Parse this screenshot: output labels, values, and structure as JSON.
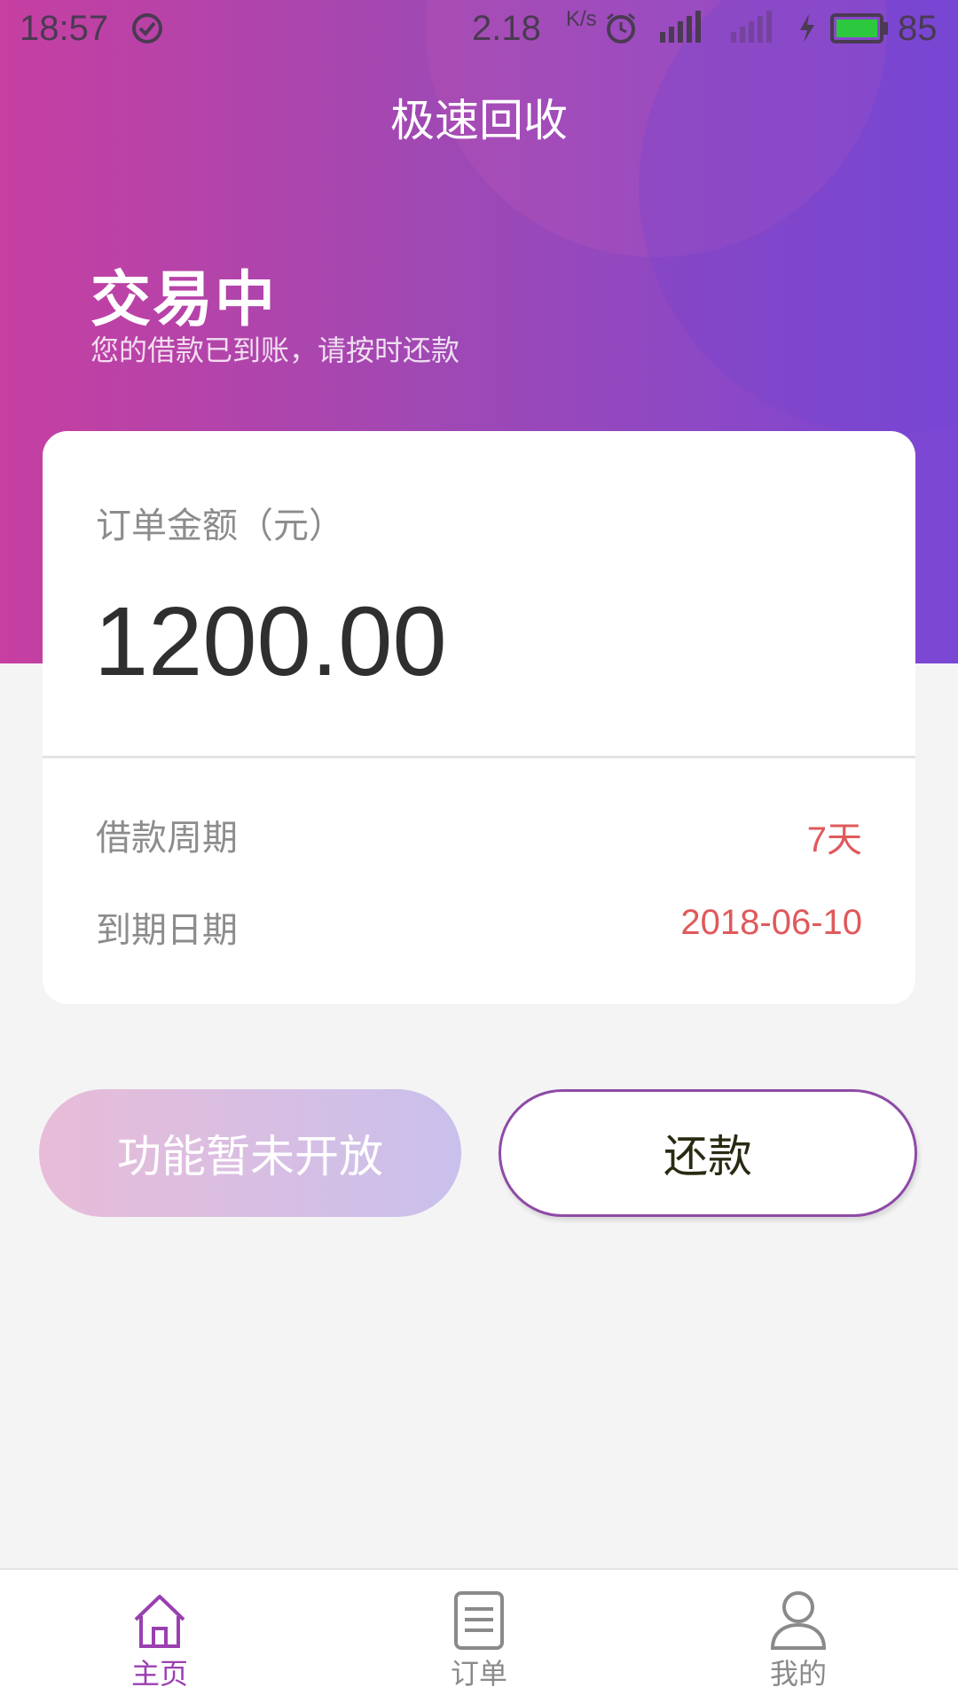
{
  "status_bar": {
    "time": "18:57",
    "net_speed": "2.18",
    "net_unit": "K/s",
    "battery": "85"
  },
  "app": {
    "title": "极速回收"
  },
  "state": {
    "title": "交易中",
    "subtitle": "您的借款已到账，请按时还款"
  },
  "order": {
    "amount_label": "订单金额（元）",
    "amount": "1200.00",
    "rows": [
      {
        "label": "借款周期",
        "value": "7天"
      },
      {
        "label": "到期日期",
        "value": "2018-06-10"
      }
    ]
  },
  "buttons": {
    "disabled_label": "功能暂未开放",
    "repay_label": "还款"
  },
  "bottom_nav": {
    "items": [
      {
        "label": "主页",
        "icon": "home-icon",
        "active": true
      },
      {
        "label": "订单",
        "icon": "document-icon",
        "active": false
      },
      {
        "label": "我的",
        "icon": "person-icon",
        "active": false
      }
    ]
  },
  "colors": {
    "gradient_start": "#c63fa1",
    "gradient_end": "#7a47d5",
    "accent_red": "#e0595b",
    "nav_active": "#9b3fb0",
    "button_border": "#8e4aa6"
  }
}
